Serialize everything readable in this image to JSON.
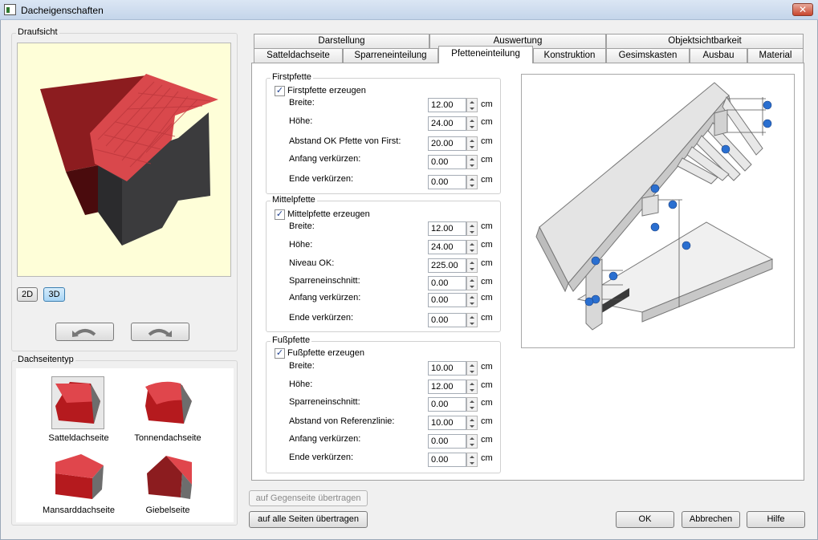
{
  "window": {
    "title": "Dacheigenschaften",
    "close_label": "✕"
  },
  "left": {
    "preview_group_label": "Draufsicht",
    "btn_2d": "2D",
    "btn_3d": "3D",
    "view_mode_selected": "3D",
    "roof_type_group_label": "Dachseitentyp",
    "roof_types": [
      {
        "label": "Satteldachseite",
        "selected": true
      },
      {
        "label": "Tonnendachseite",
        "selected": false
      },
      {
        "label": "Mansarddachseite",
        "selected": false
      },
      {
        "label": "Giebelseite",
        "selected": false
      }
    ]
  },
  "tabs": {
    "row1": [
      "Darstellung",
      "Auswertung",
      "Objektsichtbarkeit"
    ],
    "row2": [
      "Satteldachseite",
      "Sparreneinteilung",
      "Pfetteneinteilung",
      "Konstruktion",
      "Gesimskasten",
      "Ausbau",
      "Material"
    ],
    "selected": "Pfetteneinteilung"
  },
  "firstpfette": {
    "group_label": "Firstpfette",
    "checkbox_label": "Firstpfette erzeugen",
    "checked": true,
    "fields": [
      {
        "label": "Breite:",
        "value": "12.00",
        "unit": "cm"
      },
      {
        "label": "Höhe:",
        "value": "24.00",
        "unit": "cm"
      },
      {
        "label": "Abstand OK Pfette von First:",
        "value": "20.00",
        "unit": "cm"
      },
      {
        "label": "Anfang verkürzen:",
        "value": "0.00",
        "unit": "cm"
      },
      {
        "label": "Ende verkürzen:",
        "value": "0.00",
        "unit": "cm"
      }
    ]
  },
  "mittelpfette": {
    "group_label": "Mittelpfette",
    "checkbox_label": "Mittelpfette erzeugen",
    "checked": true,
    "fields": [
      {
        "label": "Breite:",
        "value": "12.00",
        "unit": "cm"
      },
      {
        "label": "Höhe:",
        "value": "24.00",
        "unit": "cm"
      },
      {
        "label": "Niveau OK:",
        "value": "225.00",
        "unit": "cm"
      },
      {
        "label": "Sparreneinschnitt:",
        "value": "0.00",
        "unit": "cm"
      },
      {
        "label": "Anfang verkürzen:",
        "value": "0.00",
        "unit": "cm"
      },
      {
        "label": "Ende verkürzen:",
        "value": "0.00",
        "unit": "cm"
      }
    ]
  },
  "fusspfette": {
    "group_label": "Fußpfette",
    "checkbox_label": "Fußpfette erzeugen",
    "checked": true,
    "fields": [
      {
        "label": "Breite:",
        "value": "10.00",
        "unit": "cm"
      },
      {
        "label": "Höhe:",
        "value": "12.00",
        "unit": "cm"
      },
      {
        "label": "Sparreneinschnitt:",
        "value": "0.00",
        "unit": "cm"
      },
      {
        "label": "Abstand von Referenzlinie:",
        "value": "10.00",
        "unit": "cm"
      },
      {
        "label": "Anfang verkürzen:",
        "value": "0.00",
        "unit": "cm"
      },
      {
        "label": "Ende verkürzen:",
        "value": "0.00",
        "unit": "cm"
      }
    ]
  },
  "footer": {
    "transfer_opposite": "auf Gegenseite übertragen",
    "transfer_all": "auf alle Seiten übertragen",
    "ok": "OK",
    "cancel": "Abbrechen",
    "help": "Hilfe"
  },
  "colors": {
    "roof_red": "#d9484c",
    "wall_dark": "#3a3a3c",
    "preview_bg": "#fefed8",
    "pin_blue": "#2a6fd0"
  }
}
